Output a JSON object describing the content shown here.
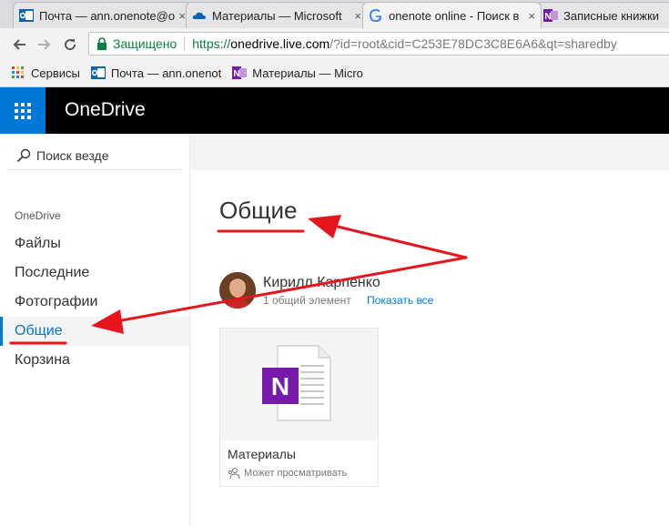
{
  "browser": {
    "tabs": [
      {
        "label": "Почта — ann.onenote@o",
        "icon": "outlook-icon",
        "close": "×"
      },
      {
        "label": "Материалы — Microsoft",
        "icon": "onedrive-cloud-icon",
        "close": "×"
      },
      {
        "label": "onenote online - Поиск в",
        "icon": "google-icon",
        "close": "×"
      },
      {
        "label": "Записные книжки",
        "icon": "onenote-icon"
      }
    ],
    "secure_label": "Защищено",
    "url_scheme": "https://",
    "url_host": "onedrive.live.com",
    "url_rest": "/?id=root&cid=C253E78DC3C8E6A6&qt=sharedby",
    "bookmarks": [
      {
        "label": "Сервисы",
        "icon": "apps-grid-icon"
      },
      {
        "label": "Почта — ann.onenot",
        "icon": "outlook-icon"
      },
      {
        "label": "Материалы — Micro",
        "icon": "onenote-icon"
      }
    ]
  },
  "app": {
    "brand": "OneDrive",
    "accent": "#0078d7"
  },
  "leftnav": {
    "search_label": "Поиск везде",
    "group_label": "OneDrive",
    "items": [
      {
        "label": "Файлы"
      },
      {
        "label": "Последние"
      },
      {
        "label": "Фотографии"
      },
      {
        "label": "Общие",
        "selected": true
      },
      {
        "label": "Корзина"
      }
    ]
  },
  "main": {
    "title": "Общие",
    "owner": {
      "name": "Кирилл Карпенко",
      "count": "1 общий элемент",
      "show_all": "Показать все"
    },
    "tile": {
      "name": "Материалы",
      "permission": "Может просматривать",
      "icon": "onenote-notebook-icon",
      "icon_letter": "N"
    }
  }
}
